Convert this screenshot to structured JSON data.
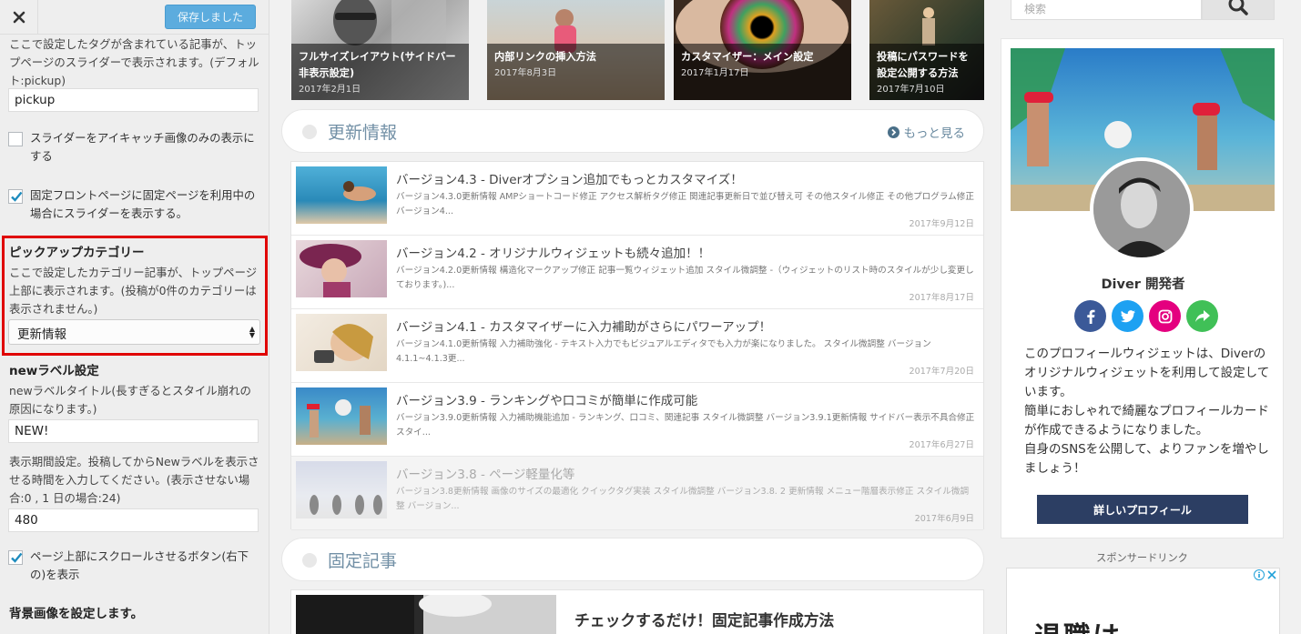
{
  "panel": {
    "close_icon": "close-icon",
    "save_label": "保存しました",
    "slider_tag_desc": "ここで設定したタグが含まれている記事が、トップページのスライダーで表示されます。(デフォルト:pickup)",
    "slider_tag_value": "pickup",
    "eyecatch_only_label": "スライダーをアイキャッチ画像のみの表示にする",
    "eyecatch_only_checked": false,
    "static_front_label": "固定フロントページに固定ページを利用中の場合にスライダーを表示する。",
    "static_front_checked": true,
    "pickup_title": "ピックアップカテゴリー",
    "pickup_desc": "ここで設定したカテゴリー記事が、トップページ上部に表示されます。(投稿が0件のカテゴリーは表示されません。)",
    "pickup_selected": "更新情報",
    "new_label_title": "newラベル設定",
    "new_label_desc": "newラベルタイトル(長すぎるとスタイル崩れの原因になります。)",
    "new_label_value": "NEW!",
    "period_desc": "表示期間設定。投稿してからNewラベルを表示させる時間を入力してください。(表示させない場合:0 , 1 日の場合:24)",
    "period_value": "480",
    "scroll_top_label": "ページ上部にスクロールさせるボタン(右下の)を表示",
    "scroll_top_checked": true,
    "bg_title": "背景画像を設定します。"
  },
  "slider": [
    {
      "title": "フルサイズレイアウト(サイドバー非表示設定)",
      "date": "2017年2月1日"
    },
    {
      "title": "内部リンクの挿入方法",
      "date": "2017年8月3日"
    },
    {
      "title": "カスタマイザー：メイン設定",
      "date": "2017年1月17日"
    },
    {
      "title": "投稿にパスワードを設定公開する方法",
      "date": "2017年7月10日"
    }
  ],
  "updates": {
    "section_title": "更新情報",
    "more_label": "もっと見る",
    "items": [
      {
        "title": "バージョン4.3 - Diverオプション追加でもっとカスタマイズ！",
        "excerpt": "バージョン4.3.0更新情報 AMPショートコード修正 アクセス解析タグ修正 関連記事更新日で並び替え可 その他スタイル修正 その他プログラム修正 バージョン4...",
        "date": "2017年9月12日"
      },
      {
        "title": "バージョン4.2 - オリジナルウィジェットも続々追加！！",
        "excerpt": "バージョン4.2.0更新情報 構造化マークアップ修正 記事一覧ウィジェット追加 スタイル微調整 -（ウィジェットのリスト時のスタイルが少し変更しております。)...",
        "date": "2017年8月17日"
      },
      {
        "title": "バージョン4.1 - カスタマイザーに入力補助がさらにパワーアップ！",
        "excerpt": "バージョン4.1.0更新情報 入力補助強化 - テキスト入力でもビジュアルエディタでも入力が楽になりました。 スタイル微調整 バージョン4.1.1~4.1.3更...",
        "date": "2017年7月20日"
      },
      {
        "title": "バージョン3.9 - ランキングや口コミが簡単に作成可能",
        "excerpt": "バージョン3.9.0更新情報 入力補助機能追加 - ランキング、口コミ、関連記事 スタイル微調整 バージョン3.9.1更新情報 サイドバー表示不具合修正 スタイ...",
        "date": "2017年6月27日"
      },
      {
        "title": "バージョン3.8 - ページ軽量化等",
        "excerpt": "バージョン3.8更新情報 画像のサイズの最適化 クイックタグ実装 スタイル微調整 バージョン3.8. 2 更新情報 メニュー階層表示修正 スタイル微調整 バージョン...",
        "date": "2017年6月9日"
      }
    ]
  },
  "pinned": {
    "section_title": "固定記事",
    "article_title": "チェックするだけ！固定記事作成方法"
  },
  "sidebar": {
    "search_placeholder": "検索",
    "profile_name": "Diver 開発者",
    "profile_desc": "このプロフィールウィジェットは、Diverのオリジナルウィジェットを利用して設定しています。\n簡単におしゃれで綺麗なプロフィールカードが作成できるようになりました。\n自身のSNSを公開して、よりファンを増やしましょう！",
    "profile_button": "詳しいプロフィール",
    "social_icons": [
      "facebook-icon",
      "twitter-icon",
      "instagram-icon",
      "share-icon"
    ],
    "social_colors": [
      "#3b5998",
      "#1da1f2",
      "#e4007f",
      "#40c057"
    ],
    "sponsor_label": "スポンサードリンク",
    "ad_text": "退職は"
  }
}
